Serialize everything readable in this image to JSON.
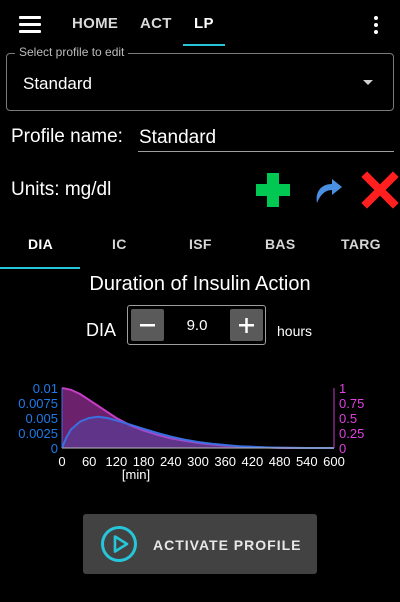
{
  "appbar": {
    "tabs": [
      {
        "label": "HOME",
        "active": false
      },
      {
        "label": "ACT",
        "active": false
      },
      {
        "label": "LP",
        "active": true
      }
    ]
  },
  "profile_select": {
    "legend": "Select profile to edit",
    "value": "Standard"
  },
  "profile_name": {
    "label": "Profile name:",
    "value": "Standard"
  },
  "units": {
    "label": "Units: mg/dl"
  },
  "icons": {
    "add": "plus-icon",
    "redo": "redo-arrow-icon",
    "delete": "close-icon"
  },
  "sub_tabs": [
    {
      "label": "DIA",
      "active": true
    },
    {
      "label": "IC",
      "active": false
    },
    {
      "label": "ISF",
      "active": false
    },
    {
      "label": "BAS",
      "active": false
    },
    {
      "label": "TARG",
      "active": false
    }
  ],
  "dia": {
    "title": "Duration of Insulin Action",
    "label": "DIA",
    "value": "9.0",
    "unit": "hours"
  },
  "chart_data": {
    "type": "area",
    "xlabel": "[min]",
    "x_ticks": [
      "0",
      "60",
      "120",
      "180",
      "240",
      "300",
      "360",
      "420",
      "480",
      "540",
      "600"
    ],
    "xlim": [
      0,
      600
    ],
    "y_left_ticks": [
      "0",
      "0.0025",
      "0.005",
      "0.0075",
      "0.01"
    ],
    "y_left_lim": [
      0,
      0.01
    ],
    "y_right_ticks": [
      "0",
      "0.25",
      "0.5",
      "0.75",
      "1"
    ],
    "y_right_lim": [
      0,
      1
    ],
    "grid": false,
    "series": [
      {
        "axis": "right",
        "color": "#c43cc4",
        "x": [
          0,
          20,
          40,
          60,
          80,
          100,
          120,
          150,
          180,
          210,
          240,
          270,
          300,
          330,
          360,
          390,
          420,
          450,
          480,
          510,
          540,
          600
        ],
        "y": [
          1.0,
          0.97,
          0.9,
          0.8,
          0.7,
          0.6,
          0.5,
          0.38,
          0.29,
          0.22,
          0.16,
          0.12,
          0.085,
          0.06,
          0.04,
          0.026,
          0.016,
          0.009,
          0.005,
          0.002,
          0.0,
          0.0
        ]
      },
      {
        "axis": "left",
        "color": "#3b6fe0",
        "x": [
          0,
          10,
          20,
          40,
          60,
          80,
          100,
          120,
          150,
          180,
          210,
          240,
          270,
          300,
          330,
          360,
          390,
          420,
          450,
          480,
          510,
          540,
          600
        ],
        "y": [
          0.0,
          0.0018,
          0.0031,
          0.0044,
          0.005,
          0.0052,
          0.005,
          0.0046,
          0.0039,
          0.0032,
          0.0025,
          0.0019,
          0.0014,
          0.001,
          0.0007,
          0.0005,
          0.0003,
          0.0002,
          0.0001,
          5e-05,
          2e-05,
          0.0,
          0.0
        ]
      }
    ]
  },
  "activate": {
    "label": "ACTIVATE PROFILE",
    "icon": "play-circle-icon"
  },
  "colors": {
    "accent": "#26c6da",
    "add_green": "#00c853",
    "delete_red": "#ff1f1f",
    "redo_blue": "#4a90e2",
    "axis_left_blue": "#1e7ae8",
    "axis_right_magenta": "#e040e0"
  }
}
